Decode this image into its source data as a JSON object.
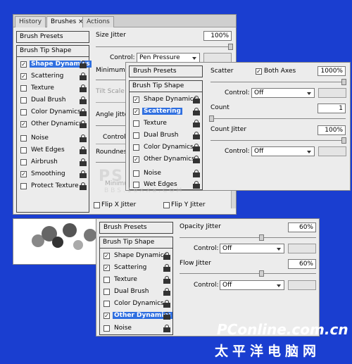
{
  "tabs": [
    {
      "label": "History"
    },
    {
      "label": "Brushes ×"
    },
    {
      "label": "Actions"
    }
  ],
  "main": {
    "presets": "Brush Presets",
    "tip_shape": "Brush Tip Shape",
    "options": [
      {
        "label": "Shape Dynamics",
        "checked": true
      },
      {
        "label": "Scattering",
        "checked": true
      },
      {
        "label": "Texture",
        "checked": false
      },
      {
        "label": "Dual Brush",
        "checked": false
      },
      {
        "label": "Color Dynamics",
        "checked": false
      },
      {
        "label": "Other Dynamics",
        "checked": true
      },
      {
        "label": "Noise",
        "checked": false
      },
      {
        "label": "Wet Edges",
        "checked": false
      },
      {
        "label": "Airbrush",
        "checked": false
      },
      {
        "label": "Smoothing",
        "checked": true
      },
      {
        "label": "Protect Texture",
        "checked": false
      }
    ],
    "size_jitter_label": "Size Jitter",
    "size_jitter_value": "100%",
    "control_label": "Control:",
    "control_value": "Pen Pressure",
    "minimum_partial": "Minimum D",
    "tilt_scale": "Tilt Scale",
    "angle_partial": "Angle Jitter",
    "control_partial": "Control",
    "roundness_partial": "Roundness",
    "minimum_round_partial": "Minimum R",
    "flip_x": "Flip X Jitter",
    "flip_y": "Flip Y Jitter"
  },
  "scatter": {
    "presets": "Brush Presets",
    "tip_shape": "Brush Tip Shape",
    "options": [
      {
        "label": "Shape Dynamics",
        "checked": true
      },
      {
        "label": "Scattering",
        "checked": true
      },
      {
        "label": "Texture",
        "checked": false
      },
      {
        "label": "Dual Brush",
        "checked": false
      },
      {
        "label": "Color Dynamics",
        "checked": false
      },
      {
        "label": "Other Dynamics",
        "checked": true
      },
      {
        "label": "Noise",
        "checked": false
      },
      {
        "label": "Wet Edges",
        "checked": false
      }
    ],
    "scatter_label": "Scatter",
    "both_axes": "Both Axes",
    "scatter_value": "1000%",
    "control_label": "Control:",
    "control_value": "Off",
    "count_label": "Count",
    "count_value": "1",
    "count_jitter_label": "Count Jitter",
    "count_jitter_value": "100%",
    "control2_label": "Control:",
    "control2_value": "Off"
  },
  "other": {
    "presets": "Brush Presets",
    "tip_shape": "Brush Tip Shape",
    "options": [
      {
        "label": "Shape Dynamics",
        "checked": true
      },
      {
        "label": "Scattering",
        "checked": true
      },
      {
        "label": "Texture",
        "checked": false
      },
      {
        "label": "Dual Brush",
        "checked": false
      },
      {
        "label": "Color Dynamics",
        "checked": false
      },
      {
        "label": "Other Dynamics",
        "checked": true
      },
      {
        "label": "Noise",
        "checked": false
      }
    ],
    "opacity_label": "Opacity Jitter",
    "opacity_value": "60%",
    "control_label": "Control:",
    "control_value": "Off",
    "flow_label": "Flow Jitter",
    "flow_value": "60%",
    "control2_label": "Control:",
    "control2_value": "Off"
  },
  "watermark": {
    "text": "BBS.16XX8.COM",
    "logo_en": "PConline.com.cn",
    "logo_cn": "太平洋电脑网"
  },
  "colors": {
    "background": "#1a3ed0",
    "selection": "#2f6fe0"
  }
}
